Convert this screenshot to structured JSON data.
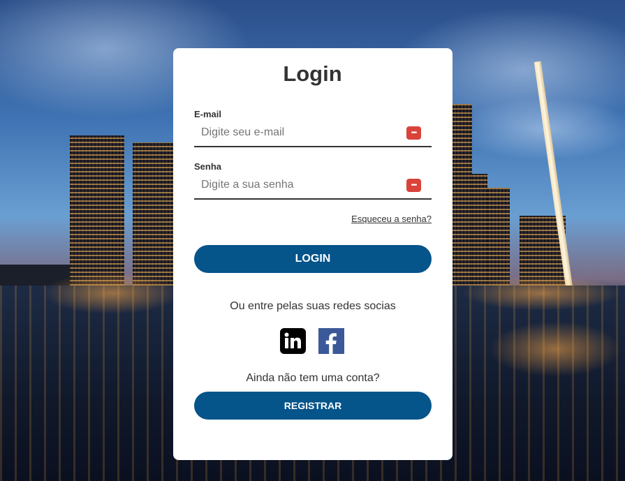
{
  "login": {
    "title": "Login",
    "email_label": "E-mail",
    "email_placeholder": "Digite seu e-mail",
    "email_value": "",
    "password_label": "Senha",
    "password_placeholder": "Digite a sua senha",
    "password_value": "",
    "password_manager_icon": "password-manager-icon",
    "forgot_link": "Esqueceu a senha?",
    "login_button": "LOGIN",
    "social_text": "Ou entre pelas suas redes socias",
    "social_icons": [
      "linkedin-icon",
      "facebook-icon"
    ],
    "no_account_text": "Ainda não tem uma conta?",
    "register_button": "REGISTRAR"
  },
  "colors": {
    "primary_button": "#05548a",
    "card_background": "#ffffff",
    "text": "#333333",
    "password_icon": "#d9433a",
    "facebook": "#3b5998",
    "linkedin": "#000000"
  }
}
